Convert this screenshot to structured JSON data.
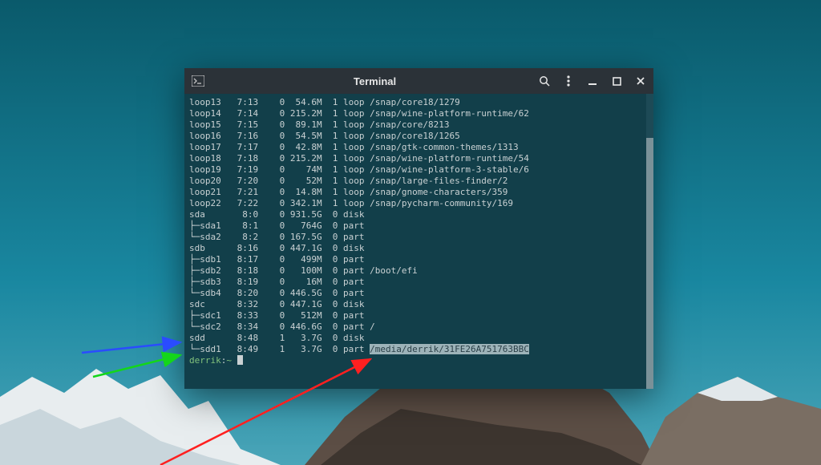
{
  "window": {
    "title": "Terminal"
  },
  "terminal": {
    "prompt_user": "derrik",
    "prompt_host": "~",
    "highlight_mount": "/media/derrik/31FE26A751763BBC",
    "rows": [
      {
        "name": "loop13",
        "mm": "7:13",
        "rm": "0",
        "size": "54.6M",
        "ro": "1",
        "type": "loop",
        "mount": "/snap/core18/1279"
      },
      {
        "name": "loop14",
        "mm": "7:14",
        "rm": "0",
        "size": "215.2M",
        "ro": "1",
        "type": "loop",
        "mount": "/snap/wine-platform-runtime/62"
      },
      {
        "name": "loop15",
        "mm": "7:15",
        "rm": "0",
        "size": "89.1M",
        "ro": "1",
        "type": "loop",
        "mount": "/snap/core/8213"
      },
      {
        "name": "loop16",
        "mm": "7:16",
        "rm": "0",
        "size": "54.5M",
        "ro": "1",
        "type": "loop",
        "mount": "/snap/core18/1265"
      },
      {
        "name": "loop17",
        "mm": "7:17",
        "rm": "0",
        "size": "42.8M",
        "ro": "1",
        "type": "loop",
        "mount": "/snap/gtk-common-themes/1313"
      },
      {
        "name": "loop18",
        "mm": "7:18",
        "rm": "0",
        "size": "215.2M",
        "ro": "1",
        "type": "loop",
        "mount": "/snap/wine-platform-runtime/54"
      },
      {
        "name": "loop19",
        "mm": "7:19",
        "rm": "0",
        "size": "74M",
        "ro": "1",
        "type": "loop",
        "mount": "/snap/wine-platform-3-stable/6"
      },
      {
        "name": "loop20",
        "mm": "7:20",
        "rm": "0",
        "size": "52M",
        "ro": "1",
        "type": "loop",
        "mount": "/snap/large-files-finder/2"
      },
      {
        "name": "loop21",
        "mm": "7:21",
        "rm": "0",
        "size": "14.8M",
        "ro": "1",
        "type": "loop",
        "mount": "/snap/gnome-characters/359"
      },
      {
        "name": "loop22",
        "mm": "7:22",
        "rm": "0",
        "size": "342.1M",
        "ro": "1",
        "type": "loop",
        "mount": "/snap/pycharm-community/169"
      },
      {
        "name": "sda",
        "mm": "8:0",
        "rm": "0",
        "size": "931.5G",
        "ro": "0",
        "type": "disk",
        "mount": ""
      },
      {
        "name": "├─sda1",
        "mm": "8:1",
        "rm": "0",
        "size": "764G",
        "ro": "0",
        "type": "part",
        "mount": ""
      },
      {
        "name": "└─sda2",
        "mm": "8:2",
        "rm": "0",
        "size": "167.5G",
        "ro": "0",
        "type": "part",
        "mount": ""
      },
      {
        "name": "sdb",
        "mm": "8:16",
        "rm": "0",
        "size": "447.1G",
        "ro": "0",
        "type": "disk",
        "mount": ""
      },
      {
        "name": "├─sdb1",
        "mm": "8:17",
        "rm": "0",
        "size": "499M",
        "ro": "0",
        "type": "part",
        "mount": ""
      },
      {
        "name": "├─sdb2",
        "mm": "8:18",
        "rm": "0",
        "size": "100M",
        "ro": "0",
        "type": "part",
        "mount": "/boot/efi"
      },
      {
        "name": "├─sdb3",
        "mm": "8:19",
        "rm": "0",
        "size": "16M",
        "ro": "0",
        "type": "part",
        "mount": ""
      },
      {
        "name": "└─sdb4",
        "mm": "8:20",
        "rm": "0",
        "size": "446.5G",
        "ro": "0",
        "type": "part",
        "mount": ""
      },
      {
        "name": "sdc",
        "mm": "8:32",
        "rm": "0",
        "size": "447.1G",
        "ro": "0",
        "type": "disk",
        "mount": ""
      },
      {
        "name": "├─sdc1",
        "mm": "8:33",
        "rm": "0",
        "size": "512M",
        "ro": "0",
        "type": "part",
        "mount": ""
      },
      {
        "name": "└─sdc2",
        "mm": "8:34",
        "rm": "0",
        "size": "446.6G",
        "ro": "0",
        "type": "part",
        "mount": "/"
      },
      {
        "name": "sdd",
        "mm": "8:48",
        "rm": "1",
        "size": "3.7G",
        "ro": "0",
        "type": "disk",
        "mount": ""
      },
      {
        "name": "└─sdd1",
        "mm": "8:49",
        "rm": "1",
        "size": "3.7G",
        "ro": "0",
        "type": "part",
        "mount": "HIGHLIGHT"
      }
    ]
  },
  "arrows": {
    "blue": {
      "color": "#2a4cff"
    },
    "green": {
      "color": "#14d61a"
    },
    "red": {
      "color": "#ff2020"
    }
  }
}
